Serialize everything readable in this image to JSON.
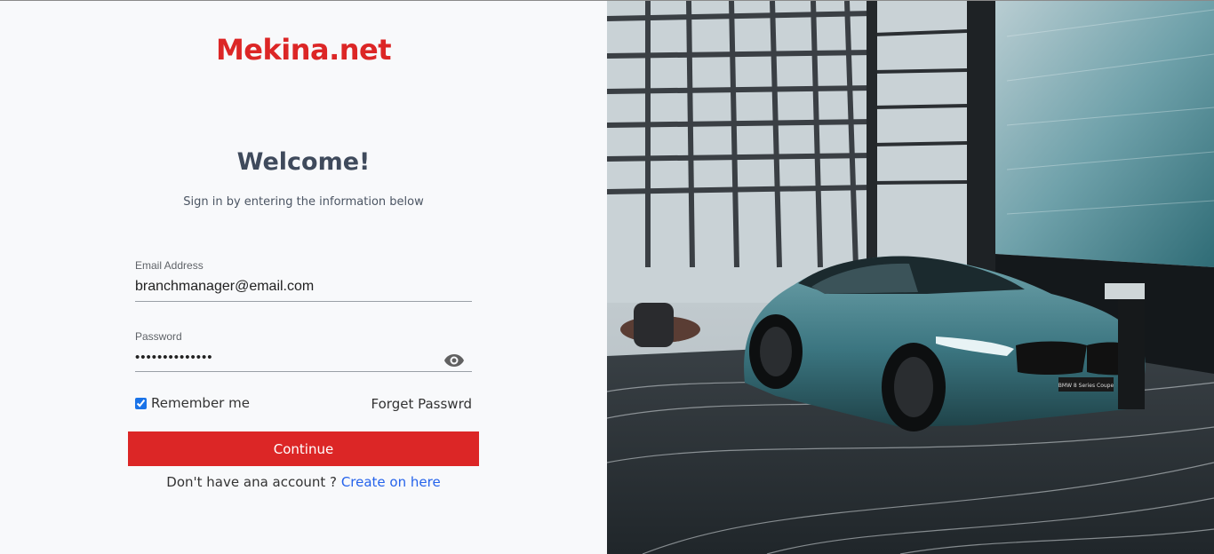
{
  "brand": {
    "name": "Mekina.net"
  },
  "login": {
    "title": "Welcome!",
    "subtitle": "Sign in by entering the information below",
    "email": {
      "label": "Email Address",
      "value": "branchmanager@email.com"
    },
    "password": {
      "label": "Password",
      "value": "••••••••••••••"
    },
    "remember_label": "Remember me",
    "remember_checked": true,
    "forgot_label": "Forget Passwrd",
    "continue_label": "Continue",
    "signup_prompt": "Don't have ana account ?",
    "signup_link": "Create on here"
  },
  "icons": {
    "password_toggle": "eye-icon"
  },
  "colors": {
    "brand": "#dc2626",
    "link": "#2563eb",
    "heading": "#3f4a5c"
  },
  "hero_image": {
    "description_icon": "car-showroom-photo",
    "plate_text": "BMW 8 Series Coupe"
  }
}
